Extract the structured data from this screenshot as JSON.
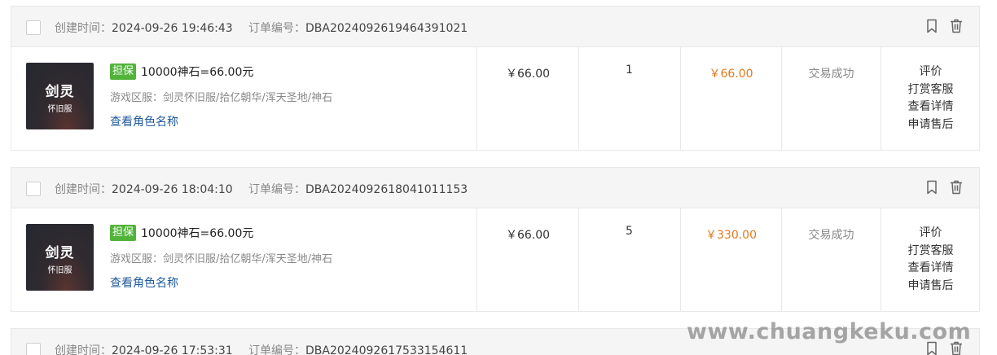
{
  "labels": {
    "created": "创建时间：",
    "order_no": "订单编号：",
    "badge": "担保",
    "server_prefix": "游戏区服：",
    "role_link": "查看角色名称",
    "thumb_line1": "剑灵",
    "thumb_line2": "怀旧服"
  },
  "orders": [
    {
      "created": "2024-09-26 19:46:43",
      "order_no": "DBA2024092619464391021",
      "title": "10000神石=66.00元",
      "server": "剑灵怀旧服/拾亿朝华/浑天圣地/神石",
      "price": "￥66.00",
      "qty": "1",
      "total": "￥66.00",
      "status": "交易成功",
      "actions": [
        "评价",
        "打赏客服",
        "查看详情",
        "申请售后"
      ]
    },
    {
      "created": "2024-09-26 18:04:10",
      "order_no": "DBA2024092618041011153",
      "title": "10000神石=66.00元",
      "server": "剑灵怀旧服/拾亿朝华/浑天圣地/神石",
      "price": "￥66.00",
      "qty": "5",
      "total": "￥330.00",
      "status": "交易成功",
      "actions": [
        "评价",
        "打赏客服",
        "查看详情",
        "申请售后"
      ]
    },
    {
      "created": "2024-09-26 17:53:31",
      "order_no": "DBA2024092617533154611"
    }
  ],
  "watermark": "www.chuangkeku.com",
  "icons": {
    "bookmark": "bookmark-icon",
    "trash": "trash-icon"
  },
  "colors": {
    "badge": "#52b33b",
    "total": "#e07a1f",
    "link": "#1f5a9e"
  }
}
